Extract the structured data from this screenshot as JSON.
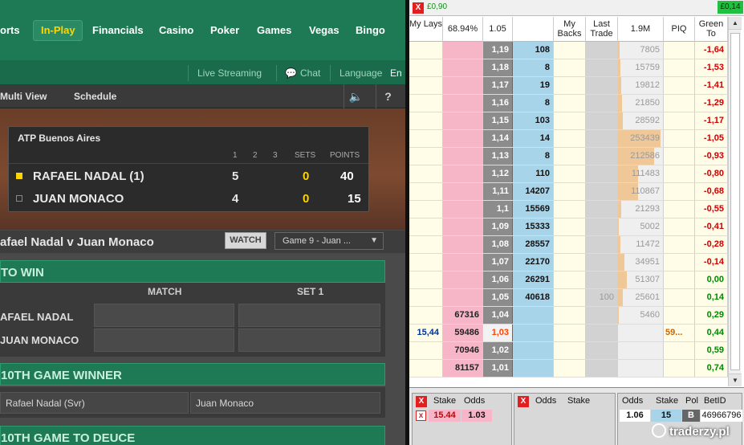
{
  "site": {
    "nav": [
      "orts",
      "In-Play",
      "Financials",
      "Casino",
      "Poker",
      "Games",
      "Vegas",
      "Bingo"
    ],
    "subnav": {
      "live_streaming": "Live Streaming",
      "chat": "Chat",
      "language": "Language",
      "language_value": "En"
    },
    "view": {
      "multi_view": "Multi View",
      "schedule": "Schedule",
      "sound_icon": "speaker-icon",
      "help": "?"
    },
    "scoreboard": {
      "title": "ATP Buenos Aires",
      "cols": [
        "1",
        "2",
        "3",
        "SETS",
        "POINTS"
      ],
      "players": [
        {
          "name": "RAFAEL NADAL (1)",
          "game": "5",
          "sets": "0",
          "points": "40",
          "serving": true
        },
        {
          "name": "JUAN MONACO",
          "game": "4",
          "sets": "0",
          "points": "15",
          "serving": false
        }
      ]
    },
    "match_title": "afael Nadal v Juan Monaco",
    "watch_label": "WATCH",
    "game_select": "Game 9 - Juan ...",
    "market1": {
      "title": "TO WIN",
      "col_match": "MATCH",
      "col_set": "SET 1",
      "rows": [
        "AFAEL NADAL",
        "JUAN MONACO"
      ]
    },
    "market2": {
      "title": "10TH GAME WINNER",
      "options": [
        "Rafael Nadal (Svr)",
        "Juan Monaco"
      ]
    },
    "market3": {
      "title": "10TH GAME TO DEUCE"
    }
  },
  "ladder": {
    "pl_left": "£0,90",
    "pl_right": "£0,14",
    "headers": {
      "my_lays": "My Lays",
      "lay_pct": "68.94%",
      "ltp": "1.05",
      "my_backs": "My Backs",
      "last_trade": "Last Trade",
      "volume": "1.9M",
      "piq": "PIQ",
      "green": "Green To"
    },
    "rows": [
      {
        "price": "1,19",
        "lay": "",
        "back": "108",
        "mylay": "",
        "last": "",
        "vol": "7805",
        "volfrac": 0.03,
        "piq": "",
        "green": "-1,64",
        "sign": "neg"
      },
      {
        "price": "1,18",
        "lay": "",
        "back": "8",
        "mylay": "",
        "last": "",
        "vol": "15759",
        "volfrac": 0.06,
        "piq": "",
        "green": "-1,53",
        "sign": "neg"
      },
      {
        "price": "1,17",
        "lay": "",
        "back": "19",
        "mylay": "",
        "last": "",
        "vol": "19812",
        "volfrac": 0.08,
        "piq": "",
        "green": "-1,41",
        "sign": "neg"
      },
      {
        "price": "1,16",
        "lay": "",
        "back": "8",
        "mylay": "",
        "last": "",
        "vol": "21850",
        "volfrac": 0.09,
        "piq": "",
        "green": "-1,29",
        "sign": "neg"
      },
      {
        "price": "1,15",
        "lay": "",
        "back": "103",
        "mylay": "",
        "last": "",
        "vol": "28592",
        "volfrac": 0.11,
        "piq": "",
        "green": "-1,17",
        "sign": "neg"
      },
      {
        "price": "1,14",
        "lay": "",
        "back": "14",
        "mylay": "",
        "last": "",
        "vol": "253439",
        "volfrac": 0.95,
        "piq": "",
        "green": "-1,05",
        "sign": "neg"
      },
      {
        "price": "1,13",
        "lay": "",
        "back": "8",
        "mylay": "",
        "last": "",
        "vol": "212586",
        "volfrac": 0.8,
        "piq": "",
        "green": "-0,93",
        "sign": "neg"
      },
      {
        "price": "1,12",
        "lay": "",
        "back": "110",
        "mylay": "",
        "last": "",
        "vol": "111483",
        "volfrac": 0.44,
        "piq": "",
        "green": "-0,80",
        "sign": "neg"
      },
      {
        "price": "1,11",
        "lay": "",
        "back": "14207",
        "mylay": "",
        "last": "",
        "vol": "110867",
        "volfrac": 0.44,
        "piq": "",
        "green": "-0,68",
        "sign": "neg"
      },
      {
        "price": "1,1",
        "lay": "",
        "back": "15569",
        "mylay": "",
        "last": "",
        "vol": "21293",
        "volfrac": 0.08,
        "piq": "",
        "green": "-0,55",
        "sign": "neg"
      },
      {
        "price": "1,09",
        "lay": "",
        "back": "15333",
        "mylay": "",
        "last": "",
        "vol": "5002",
        "volfrac": 0.02,
        "piq": "",
        "green": "-0,41",
        "sign": "neg"
      },
      {
        "price": "1,08",
        "lay": "",
        "back": "28557",
        "mylay": "",
        "last": "",
        "vol": "11472",
        "volfrac": 0.05,
        "piq": "",
        "green": "-0,28",
        "sign": "neg"
      },
      {
        "price": "1,07",
        "lay": "",
        "back": "22170",
        "mylay": "",
        "last": "",
        "vol": "34951",
        "volfrac": 0.14,
        "piq": "",
        "green": "-0,14",
        "sign": "neg"
      },
      {
        "price": "1,06",
        "lay": "",
        "back": "26291",
        "mylay": "",
        "last": "",
        "vol": "51307",
        "volfrac": 0.2,
        "piq": "",
        "green": "0,00",
        "sign": "pos"
      },
      {
        "price": "1,05",
        "lay": "",
        "back": "40618",
        "mylay": "",
        "last": "100",
        "vol": "25601",
        "volfrac": 0.1,
        "piq": "",
        "green": "0,14",
        "sign": "pos"
      },
      {
        "price": "1,04",
        "lay": "67316",
        "back": "",
        "mylay": "",
        "last": "",
        "vol": "5460",
        "volfrac": 0.02,
        "piq": "",
        "green": "0,29",
        "sign": "pos"
      },
      {
        "price": "1,03",
        "lay": "59486",
        "back": "",
        "mylay": "15,44",
        "last": "",
        "vol": "",
        "volfrac": 0,
        "piq": "59...",
        "green": "0,44",
        "sign": "pos",
        "ltp": true
      },
      {
        "price": "1,02",
        "lay": "70946",
        "back": "",
        "mylay": "",
        "last": "",
        "vol": "",
        "volfrac": 0,
        "piq": "",
        "green": "0,59",
        "sign": "pos"
      },
      {
        "price": "1,01",
        "lay": "81157",
        "back": "",
        "mylay": "",
        "last": "",
        "vol": "",
        "volfrac": 0,
        "piq": "",
        "green": "0,74",
        "sign": "pos"
      }
    ]
  },
  "bottom": {
    "lay_panel": {
      "h_stake": "Stake",
      "h_odds": "Odds",
      "stake": "15.44",
      "odds": "1.03"
    },
    "back_panel": {
      "h_odds": "Odds",
      "h_stake": "Stake"
    },
    "matched": {
      "h_odds": "Odds",
      "h_stake": "Stake",
      "h_pol": "Pol",
      "h_betid": "BetID",
      "odds": "1.06",
      "stake": "15",
      "pol": "B",
      "betid": "46966796"
    }
  },
  "watermark": "traderzy.pl",
  "colors": {
    "green_nav": "#1e7a55",
    "lay_pink": "#f7b6c8",
    "back_blue": "#a8d4ea",
    "price_gray": "#8c8c8c",
    "close_red": "#e02020"
  }
}
